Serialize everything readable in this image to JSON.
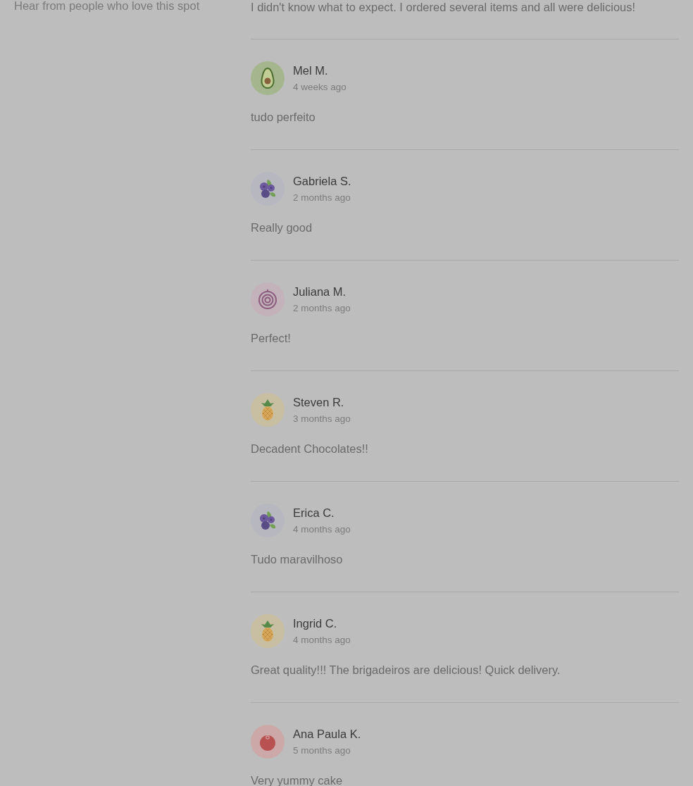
{
  "sidebar": {
    "subtitle": "Hear from people who love this spot"
  },
  "reviews": [
    {
      "text": "I didn't know what to expect. I ordered several items and all were delicious!"
    },
    {
      "name": "Mel M.",
      "time": "4 weeks ago",
      "kind": "avocado",
      "text": "tudo perfeito"
    },
    {
      "name": "Gabriela S.",
      "time": "2 months ago",
      "kind": "berries",
      "text": "Really good"
    },
    {
      "name": "Juliana M.",
      "time": "2 months ago",
      "kind": "onion",
      "text": "Perfect!"
    },
    {
      "name": "Steven R.",
      "time": "3 months ago",
      "kind": "pineapple",
      "text": "Decadent Chocolates!!"
    },
    {
      "name": "Erica C.",
      "time": "4 months ago",
      "kind": "berries",
      "text": "Tudo maravilhoso"
    },
    {
      "name": "Ingrid C.",
      "time": "4 months ago",
      "kind": "pineapple",
      "text": "Great quality!!! The brigadeiros are delicious! Quick delivery."
    },
    {
      "name": "Ana Paula K.",
      "time": "5 months ago",
      "kind": "tomato",
      "text": "Very yummy cake"
    }
  ]
}
